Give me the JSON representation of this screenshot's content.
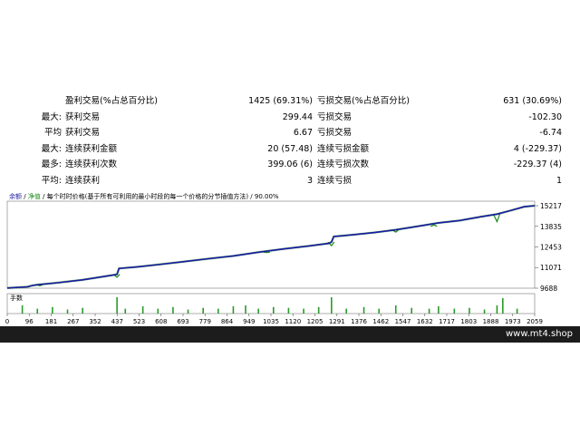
{
  "stats": [
    {
      "prefix": "",
      "label": "盈利交易(%占总百分比)",
      "value": "1425 (69.31%)",
      "label2": "亏损交易(%占总百分比)",
      "value2": "631 (30.69%)"
    },
    {
      "prefix": "最大:",
      "label": "获利交易",
      "value": "299.44",
      "label2": "亏损交易",
      "value2": "-102.30"
    },
    {
      "prefix": "平均",
      "label": "获利交易",
      "value": "6.67",
      "label2": "亏损交易",
      "value2": "-6.74"
    },
    {
      "prefix": "最大:",
      "label": "连续获利金额",
      "value": "20 (57.48)",
      "label2": "连续亏损金额",
      "value2": "4 (-229.37)"
    },
    {
      "prefix": "最多:",
      "label": "连续获利次数",
      "value": "399.06 (6)",
      "label2": "连续亏损次数",
      "value2": "-229.37 (4)"
    },
    {
      "prefix": "平均:",
      "label": "连续获利",
      "value": "3",
      "label2": "连续亏损",
      "value2": "1"
    }
  ],
  "equity_caption": {
    "balance": "余额",
    "sep": " / ",
    "equity": "净值",
    "rest": " / 每个时时价格(基于所有可利用的最小时段的每一个价格的分节插值方法) / 90.00%"
  },
  "volume_label": "手数",
  "watermark": "www.mt4.shop",
  "chart_data": {
    "type": "line",
    "series": [
      {
        "name": "余额",
        "color": "#1a1aa0"
      },
      {
        "name": "净值",
        "color": "#1a8a1a"
      }
    ],
    "x_ticks": [
      "0",
      "96",
      "181",
      "267",
      "352",
      "437",
      "523",
      "608",
      "693",
      "779",
      "864",
      "949",
      "1035",
      "1120",
      "1205",
      "1291",
      "1376",
      "1462",
      "1547",
      "1632",
      "1717",
      "1803",
      "1888",
      "1973",
      "2059"
    ],
    "y_ticks": [
      9688,
      11071,
      12453,
      13835,
      15217
    ],
    "ylim": [
      9688,
      15400
    ],
    "xlim": [
      0,
      2100
    ],
    "balance_points": [
      [
        0,
        9700
      ],
      [
        80,
        9780
      ],
      [
        100,
        9870
      ],
      [
        120,
        9920
      ],
      [
        200,
        10050
      ],
      [
        300,
        10250
      ],
      [
        420,
        10560
      ],
      [
        437,
        10620
      ],
      [
        445,
        11010
      ],
      [
        520,
        11120
      ],
      [
        600,
        11270
      ],
      [
        700,
        11460
      ],
      [
        800,
        11660
      ],
      [
        900,
        11850
      ],
      [
        1000,
        12100
      ],
      [
        1100,
        12320
      ],
      [
        1200,
        12520
      ],
      [
        1280,
        12690
      ],
      [
        1291,
        12780
      ],
      [
        1300,
        13150
      ],
      [
        1376,
        13270
      ],
      [
        1462,
        13420
      ],
      [
        1547,
        13600
      ],
      [
        1632,
        13830
      ],
      [
        1717,
        14070
      ],
      [
        1803,
        14230
      ],
      [
        1888,
        14480
      ],
      [
        1950,
        14650
      ],
      [
        2000,
        14880
      ],
      [
        2059,
        15150
      ],
      [
        2100,
        15217
      ]
    ],
    "equity_dips": [
      [
        130,
        9850
      ],
      [
        437,
        10420
      ],
      [
        1035,
        12080
      ],
      [
        1291,
        12540
      ],
      [
        1547,
        13450
      ],
      [
        1700,
        13930
      ],
      [
        1950,
        14150
      ]
    ],
    "volume_bars": [
      [
        60,
        0.5
      ],
      [
        120,
        0.3
      ],
      [
        180,
        0.4
      ],
      [
        240,
        0.25
      ],
      [
        300,
        0.35
      ],
      [
        437,
        1.0
      ],
      [
        470,
        0.3
      ],
      [
        540,
        0.45
      ],
      [
        600,
        0.3
      ],
      [
        660,
        0.4
      ],
      [
        720,
        0.25
      ],
      [
        780,
        0.35
      ],
      [
        840,
        0.3
      ],
      [
        900,
        0.45
      ],
      [
        949,
        0.5
      ],
      [
        1000,
        0.3
      ],
      [
        1060,
        0.4
      ],
      [
        1120,
        0.35
      ],
      [
        1180,
        0.3
      ],
      [
        1240,
        0.4
      ],
      [
        1291,
        1.0
      ],
      [
        1350,
        0.3
      ],
      [
        1420,
        0.4
      ],
      [
        1480,
        0.3
      ],
      [
        1547,
        0.5
      ],
      [
        1610,
        0.35
      ],
      [
        1680,
        0.3
      ],
      [
        1717,
        0.45
      ],
      [
        1780,
        0.3
      ],
      [
        1840,
        0.35
      ],
      [
        1900,
        0.25
      ],
      [
        1950,
        0.5
      ],
      [
        1973,
        0.95
      ],
      [
        2030,
        0.3
      ]
    ]
  }
}
